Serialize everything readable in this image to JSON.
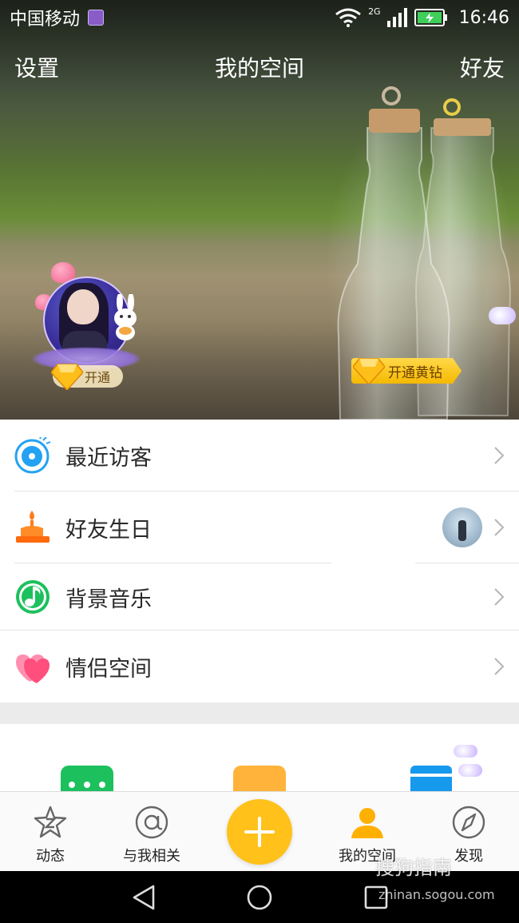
{
  "status_bar": {
    "carrier": "中国移动",
    "network": "2G",
    "time": "16:46"
  },
  "header": {
    "left": "设置",
    "title": "我的空间",
    "right": "好友"
  },
  "cover": {
    "avatar_badge": "开通",
    "vip_badge": "开通黄钻"
  },
  "menu": [
    {
      "label": "最近访客",
      "icon": "visitor-eye-icon",
      "color": "#23a2f3"
    },
    {
      "label": "好友生日",
      "icon": "birthday-cake-icon",
      "color": "#ff7b1a"
    },
    {
      "label": "背景音乐",
      "icon": "music-note-icon",
      "color": "#1cc05d"
    },
    {
      "label": "情侣空间",
      "icon": "heart-icon",
      "color": "#ff4f7c"
    }
  ],
  "tabs": [
    {
      "label": "动态",
      "icon": "star-z-icon"
    },
    {
      "label": "与我相关",
      "icon": "at-icon"
    },
    {
      "label": "",
      "icon": "plus-icon"
    },
    {
      "label": "我的空间",
      "icon": "person-icon"
    },
    {
      "label": "发现",
      "icon": "compass-icon"
    }
  ],
  "watermark": {
    "brand": "搜狗指南",
    "url": "zhinan.sogou.com"
  },
  "colors": {
    "accent": "#ffc11a",
    "tab_active": "#ffb000"
  }
}
